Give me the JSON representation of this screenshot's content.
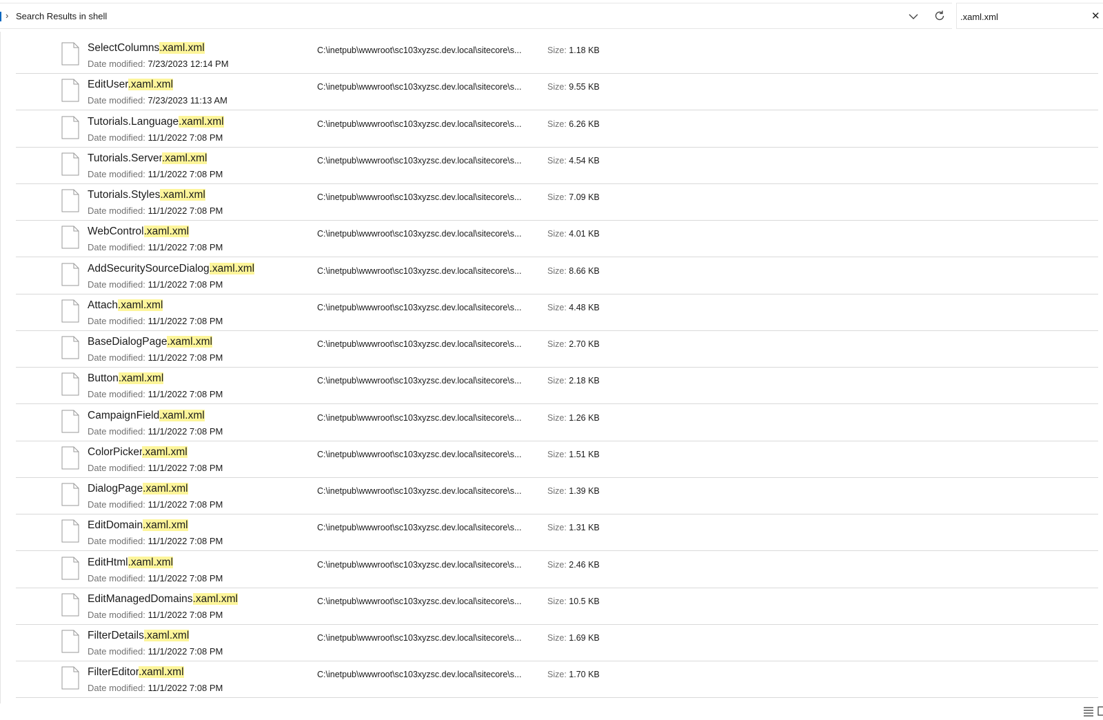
{
  "address_bar": {
    "path_label": "Search Results in shell"
  },
  "search": {
    "query": ".xaml.xml"
  },
  "labels": {
    "date_modified": "Date modified:",
    "size": "Size:"
  },
  "files": [
    {
      "base": "SelectColumns",
      "match": ".xaml.xml",
      "date": "7/23/2023 12:14 PM",
      "path": "C:\\inetpub\\wwwroot\\sc103xyzsc.dev.local\\sitecore\\s...",
      "size": "1.18 KB"
    },
    {
      "base": "EditUser",
      "match": ".xaml.xml",
      "date": "7/23/2023 11:13 AM",
      "path": "C:\\inetpub\\wwwroot\\sc103xyzsc.dev.local\\sitecore\\s...",
      "size": "9.55 KB"
    },
    {
      "base": "Tutorials.Language",
      "match": ".xaml.xml",
      "date": "11/1/2022 7:08 PM",
      "path": "C:\\inetpub\\wwwroot\\sc103xyzsc.dev.local\\sitecore\\s...",
      "size": "6.26 KB"
    },
    {
      "base": "Tutorials.Server",
      "match": ".xaml.xml",
      "date": "11/1/2022 7:08 PM",
      "path": "C:\\inetpub\\wwwroot\\sc103xyzsc.dev.local\\sitecore\\s...",
      "size": "4.54 KB"
    },
    {
      "base": "Tutorials.Styles",
      "match": ".xaml.xml",
      "date": "11/1/2022 7:08 PM",
      "path": "C:\\inetpub\\wwwroot\\sc103xyzsc.dev.local\\sitecore\\s...",
      "size": "7.09 KB"
    },
    {
      "base": "WebControl",
      "match": ".xaml.xml",
      "date": "11/1/2022 7:08 PM",
      "path": "C:\\inetpub\\wwwroot\\sc103xyzsc.dev.local\\sitecore\\s...",
      "size": "4.01 KB"
    },
    {
      "base": "AddSecuritySourceDialog",
      "match": ".xaml.xml",
      "date": "11/1/2022 7:08 PM",
      "path": "C:\\inetpub\\wwwroot\\sc103xyzsc.dev.local\\sitecore\\s...",
      "size": "8.66 KB"
    },
    {
      "base": "Attach",
      "match": ".xaml.xml",
      "date": "11/1/2022 7:08 PM",
      "path": "C:\\inetpub\\wwwroot\\sc103xyzsc.dev.local\\sitecore\\s...",
      "size": "4.48 KB"
    },
    {
      "base": "BaseDialogPage",
      "match": ".xaml.xml",
      "date": "11/1/2022 7:08 PM",
      "path": "C:\\inetpub\\wwwroot\\sc103xyzsc.dev.local\\sitecore\\s...",
      "size": "2.70 KB"
    },
    {
      "base": "Button",
      "match": ".xaml.xml",
      "date": "11/1/2022 7:08 PM",
      "path": "C:\\inetpub\\wwwroot\\sc103xyzsc.dev.local\\sitecore\\s...",
      "size": "2.18 KB"
    },
    {
      "base": "CampaignField",
      "match": ".xaml.xml",
      "date": "11/1/2022 7:08 PM",
      "path": "C:\\inetpub\\wwwroot\\sc103xyzsc.dev.local\\sitecore\\s...",
      "size": "1.26 KB"
    },
    {
      "base": "ColorPicker",
      "match": ".xaml.xml",
      "date": "11/1/2022 7:08 PM",
      "path": "C:\\inetpub\\wwwroot\\sc103xyzsc.dev.local\\sitecore\\s...",
      "size": "1.51 KB"
    },
    {
      "base": "DialogPage",
      "match": ".xaml.xml",
      "date": "11/1/2022 7:08 PM",
      "path": "C:\\inetpub\\wwwroot\\sc103xyzsc.dev.local\\sitecore\\s...",
      "size": "1.39 KB"
    },
    {
      "base": "EditDomain",
      "match": ".xaml.xml",
      "date": "11/1/2022 7:08 PM",
      "path": "C:\\inetpub\\wwwroot\\sc103xyzsc.dev.local\\sitecore\\s...",
      "size": "1.31 KB"
    },
    {
      "base": "EditHtml",
      "match": ".xaml.xml",
      "date": "11/1/2022 7:08 PM",
      "path": "C:\\inetpub\\wwwroot\\sc103xyzsc.dev.local\\sitecore\\s...",
      "size": "2.46 KB"
    },
    {
      "base": "EditManagedDomains",
      "match": ".xaml.xml",
      "date": "11/1/2022 7:08 PM",
      "path": "C:\\inetpub\\wwwroot\\sc103xyzsc.dev.local\\sitecore\\s...",
      "size": "10.5 KB"
    },
    {
      "base": "FilterDetails",
      "match": ".xaml.xml",
      "date": "11/1/2022 7:08 PM",
      "path": "C:\\inetpub\\wwwroot\\sc103xyzsc.dev.local\\sitecore\\s...",
      "size": "1.69 KB"
    },
    {
      "base": "FilterEditor",
      "match": ".xaml.xml",
      "date": "11/1/2022 7:08 PM",
      "path": "C:\\inetpub\\wwwroot\\sc103xyzsc.dev.local\\sitecore\\s...",
      "size": "1.70 KB"
    }
  ],
  "icons": {
    "address_chevron": "chevron-right-icon",
    "address_dropdown": "chevron-down-icon",
    "refresh": "refresh-icon",
    "clear_search": "close-icon",
    "file": "file-icon",
    "details_view": "details-view-icon",
    "tiles_view": "tiles-view-icon"
  },
  "colors": {
    "accent": "#0067c0",
    "highlight": "#fdf59a",
    "label": "#717171",
    "divider": "#d9d9d9"
  }
}
